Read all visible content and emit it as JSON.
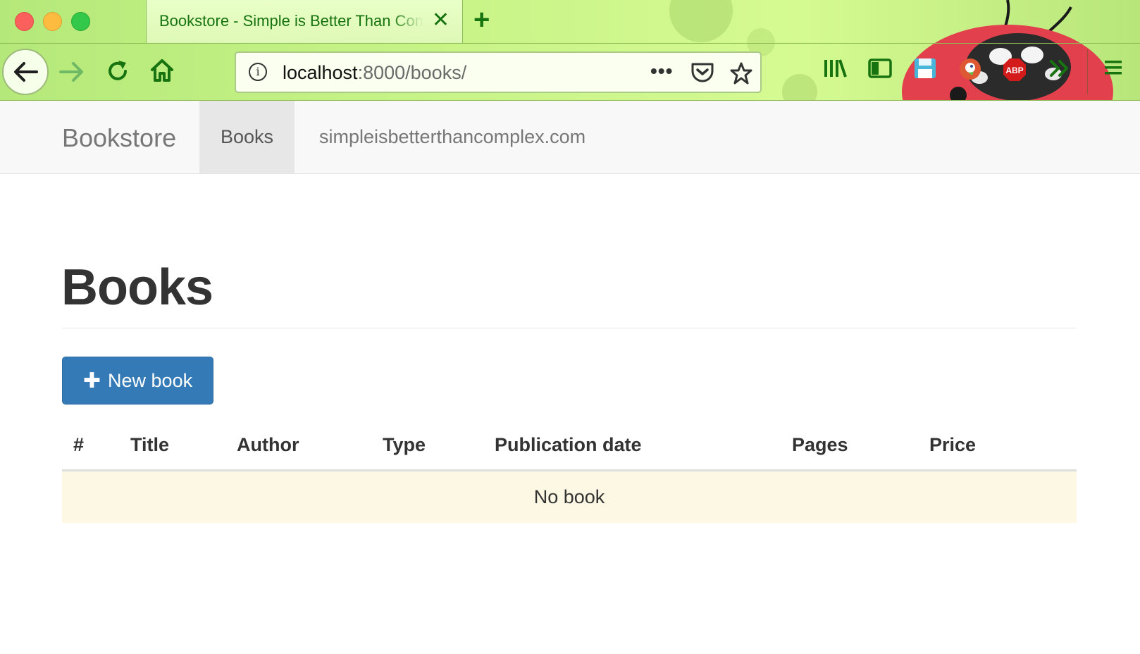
{
  "browser": {
    "tab": {
      "title": "Bookstore - Simple is Better Than Complex"
    },
    "url": {
      "host": "localhost",
      "rest": ":8000/books/"
    },
    "colors": {
      "chrome_green": "#17730f"
    }
  },
  "site": {
    "brand": "Bookstore",
    "nav": [
      {
        "label": "Books",
        "active": true
      },
      {
        "label": "simpleisbetterthancomplex.com",
        "active": false
      }
    ]
  },
  "main": {
    "title": "Books",
    "new_button": {
      "label": "New book",
      "icon": "plus-icon",
      "color": "#337ab7"
    },
    "table": {
      "columns": [
        "#",
        "Title",
        "Author",
        "Type",
        "Publication date",
        "Pages",
        "Price"
      ],
      "empty_message": "No book",
      "empty_row_color": "#fcf8e3"
    }
  }
}
